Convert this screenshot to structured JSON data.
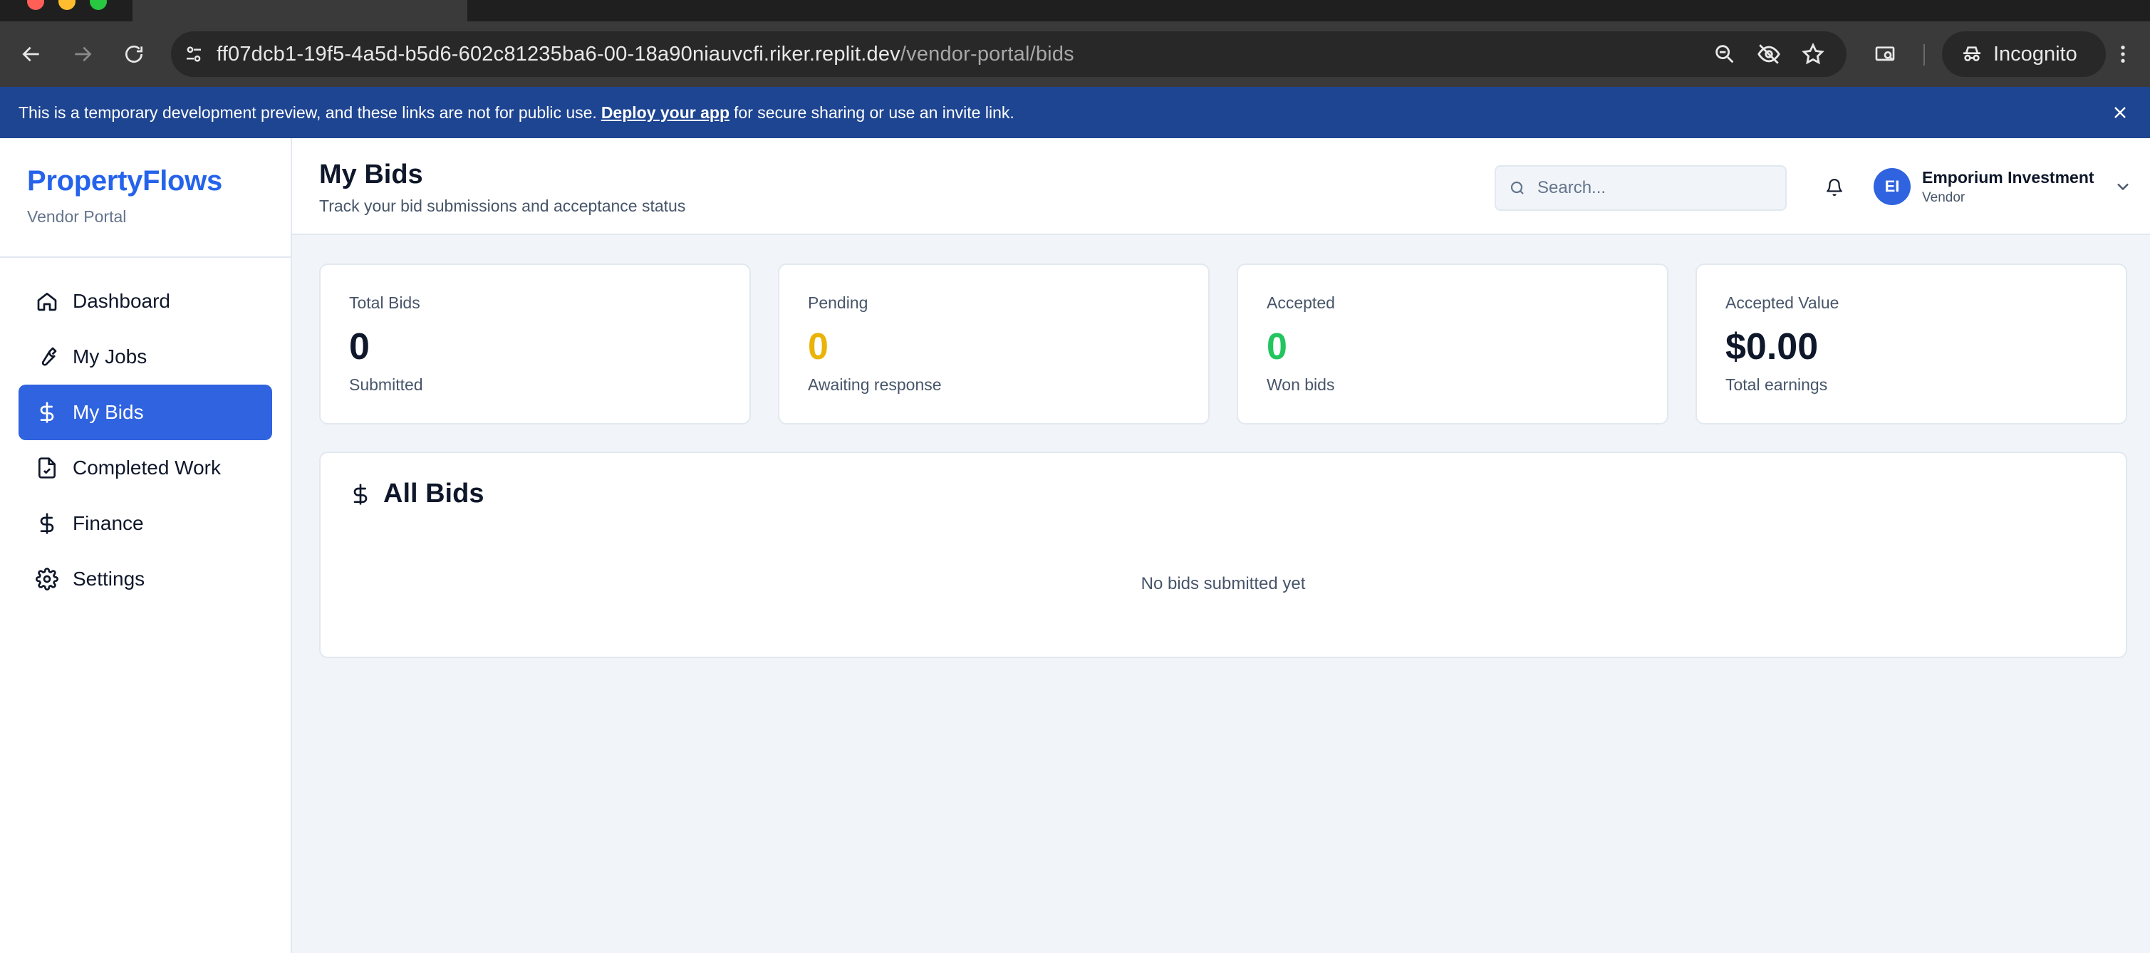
{
  "browser": {
    "url_host": "ff07dcb1-19f5-4a5d-b5d6-602c81235ba6-00-18a90niauvcfi.riker.replit.dev",
    "url_path": "/vendor-portal/bids",
    "incognito_label": "Incognito"
  },
  "banner": {
    "text_before": "This is a temporary development preview, and these links are not for public use.",
    "link_text": "Deploy your app",
    "text_after": "for secure sharing or use an invite link."
  },
  "sidebar": {
    "brand_title": "PropertyFlows",
    "brand_subtitle": "Vendor Portal",
    "items": [
      {
        "label": "Dashboard",
        "icon": "home-icon"
      },
      {
        "label": "My Jobs",
        "icon": "wrench-icon"
      },
      {
        "label": "My Bids",
        "icon": "dollar-icon",
        "active": true
      },
      {
        "label": "Completed Work",
        "icon": "file-check-icon"
      },
      {
        "label": "Finance",
        "icon": "dollar-icon"
      },
      {
        "label": "Settings",
        "icon": "gear-icon"
      }
    ]
  },
  "header": {
    "title": "My Bids",
    "subtitle": "Track your bid submissions and acceptance status",
    "search_placeholder": "Search...",
    "user": {
      "initials": "EI",
      "name": "Emporium Investment",
      "role": "Vendor"
    }
  },
  "stats": [
    {
      "label": "Total Bids",
      "value": "0",
      "caption": "Submitted",
      "color": "#0f172a"
    },
    {
      "label": "Pending",
      "value": "0",
      "caption": "Awaiting response",
      "color": "#eab308"
    },
    {
      "label": "Accepted",
      "value": "0",
      "caption": "Won bids",
      "color": "#22c55e"
    },
    {
      "label": "Accepted Value",
      "value": "$0.00",
      "caption": "Total earnings",
      "color": "#0f172a"
    }
  ],
  "bids_panel": {
    "title": "All Bids",
    "empty_text": "No bids submitted yet"
  },
  "colors": {
    "brand": "#2563eb",
    "active_nav": "#2f63df",
    "banner": "#1e4591"
  }
}
